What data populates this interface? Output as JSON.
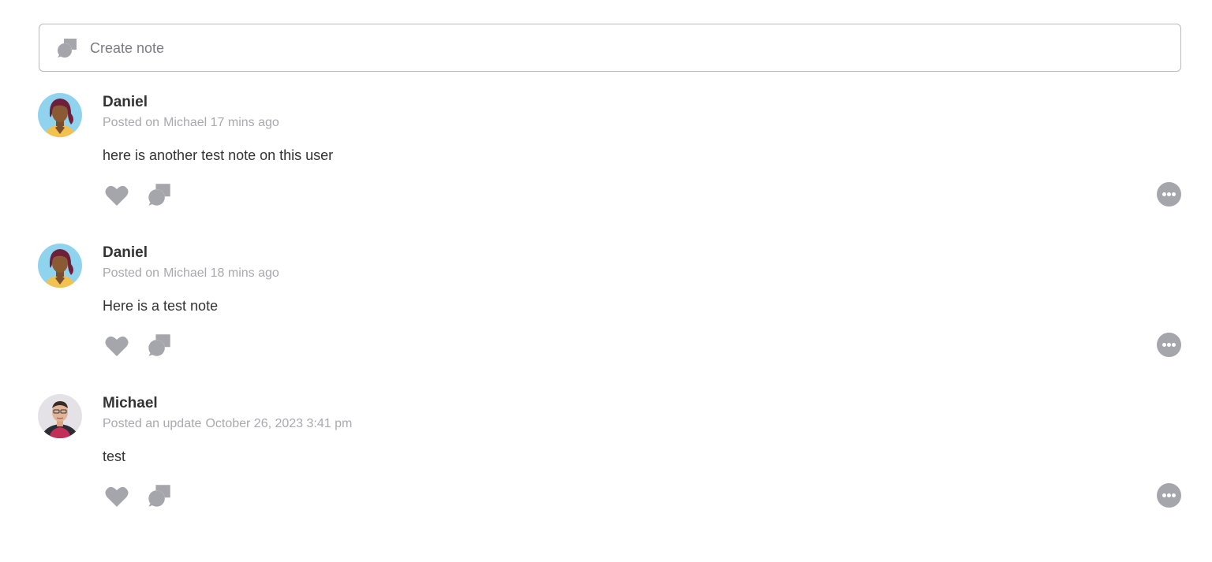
{
  "create_note": {
    "label": "Create note",
    "icon": "comment-bubbles-icon"
  },
  "posts": [
    {
      "author": "Daniel",
      "action": "Posted on",
      "time": "Michael 17 mins ago",
      "text": "here is another test note on this user",
      "avatar": "avatar-woman-illustration"
    },
    {
      "author": "Daniel",
      "action": "Posted on",
      "time": "Michael 18 mins ago",
      "text": "Here is a test note",
      "avatar": "avatar-woman-illustration"
    },
    {
      "author": "Michael",
      "action": "Posted an update",
      "time": "October 26, 2023 3:41 pm",
      "text": "test",
      "avatar": "avatar-photo"
    }
  ],
  "colors": {
    "icon_gray": "#a5a6ab",
    "meta_gray": "#a9a9ae",
    "border_gray": "#b9b9be",
    "text_dark": "#333333"
  }
}
